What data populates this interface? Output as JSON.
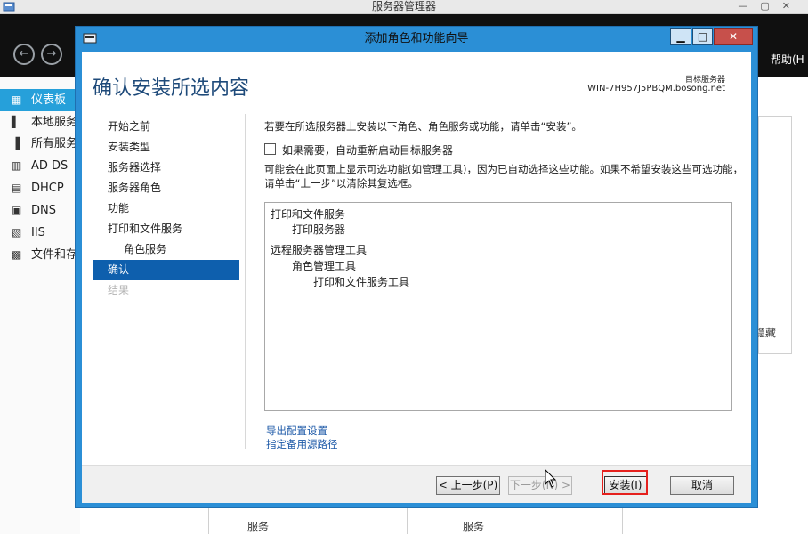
{
  "background_window": {
    "title": "服务器管理器",
    "help_menu": "帮助(H",
    "sidebar": [
      {
        "label": "仪表板",
        "icon": "dashboard-icon",
        "active": true
      },
      {
        "label": "本地服务",
        "icon": "local-server-icon",
        "active": false
      },
      {
        "label": "所有服务",
        "icon": "all-servers-icon",
        "active": false
      },
      {
        "label": "AD DS",
        "icon": "ad-ds-icon",
        "active": false
      },
      {
        "label": "DHCP",
        "icon": "dhcp-icon",
        "active": false
      },
      {
        "label": "DNS",
        "icon": "dns-icon",
        "active": false
      },
      {
        "label": "IIS",
        "icon": "iis-icon",
        "active": false
      },
      {
        "label": "文件和存",
        "icon": "file-storage-icon",
        "active": false
      }
    ],
    "hide_link": "隐藏",
    "services_label_1": "服务",
    "services_label_2": "服务"
  },
  "dialog": {
    "title": "添加角色和功能向导",
    "heading": "确认安装所选内容",
    "target_label": "目标服务器",
    "target_server": "WIN-7H957J5PBQM.bosong.net",
    "nav": [
      {
        "label": "开始之前",
        "state": "normal"
      },
      {
        "label": "安装类型",
        "state": "normal"
      },
      {
        "label": "服务器选择",
        "state": "normal"
      },
      {
        "label": "服务器角色",
        "state": "normal"
      },
      {
        "label": "功能",
        "state": "normal"
      },
      {
        "label": "打印和文件服务",
        "state": "normal"
      },
      {
        "label": "角色服务",
        "state": "sub"
      },
      {
        "label": "确认",
        "state": "active"
      },
      {
        "label": "结果",
        "state": "disabled"
      }
    ],
    "intro": "若要在所选服务器上安装以下角色、角色服务或功能，请单击“安装”。",
    "restart_checkbox_label": "如果需要，自动重新启动目标服务器",
    "restart_checked": false,
    "notice": "可能会在此页面上显示可选功能(如管理工具)，因为已自动选择这些功能。如果不希望安装这些可选功能，请单击“上一步”以清除其复选框。",
    "items": [
      {
        "label": "打印和文件服务",
        "level": 0
      },
      {
        "label": "打印服务器",
        "level": 1
      },
      {
        "label": "远程服务器管理工具",
        "level": 0
      },
      {
        "label": "角色管理工具",
        "level": 1
      },
      {
        "label": "打印和文件服务工具",
        "level": 2
      }
    ],
    "link_export": "导出配置设置",
    "link_alt_source": "指定备用源路径",
    "buttons": {
      "previous": "< 上一步(P)",
      "next": "下一步(N) >",
      "install": "安装(I)",
      "cancel": "取消"
    }
  }
}
